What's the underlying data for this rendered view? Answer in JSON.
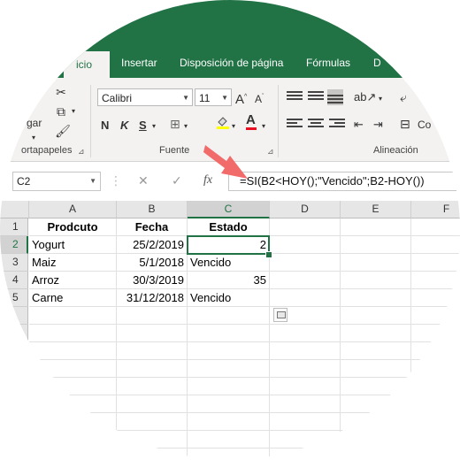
{
  "ribbon": {
    "tabs": [
      {
        "label": "icio",
        "active": true
      },
      {
        "label": "Insertar",
        "active": false
      },
      {
        "label": "Disposición de página",
        "active": false
      },
      {
        "label": "Fórmulas",
        "active": false
      },
      {
        "label": "D",
        "active": false
      }
    ],
    "clipboard": {
      "paste_label": "gar",
      "group_label": "ortapapeles"
    },
    "font": {
      "family": "Calibri",
      "size": "11",
      "bold": "N",
      "italic": "K",
      "underline": "S",
      "grow": "A",
      "shrink": "A",
      "color_letter": "A",
      "group_label": "Fuente"
    },
    "alignment": {
      "group_label": "Alineación",
      "wrap_label": "Co"
    }
  },
  "formula_bar": {
    "name_box": "C2",
    "cancel_icon": "✕",
    "enter_icon": "✓",
    "fx_label": "fx",
    "formula": "=SI(B2<HOY();\"Vencido\";B2-HOY())"
  },
  "grid": {
    "columns": [
      "A",
      "B",
      "C",
      "D",
      "E",
      "F"
    ],
    "rows": [
      "1",
      "2",
      "3",
      "4",
      "5"
    ],
    "cells": [
      [
        "Prodcuto",
        "Fecha",
        "Estado"
      ],
      [
        "Yogurt",
        "25/2/2019",
        "2"
      ],
      [
        "Maiz",
        "5/1/2018",
        "Vencido"
      ],
      [
        "Arroz",
        "30/3/2019",
        "35"
      ],
      [
        "Carne",
        "31/12/2018",
        "Vencido"
      ]
    ],
    "active_cell": "C2"
  },
  "colors": {
    "accent": "#217346",
    "annotation_arrow": "#f26b6b"
  }
}
